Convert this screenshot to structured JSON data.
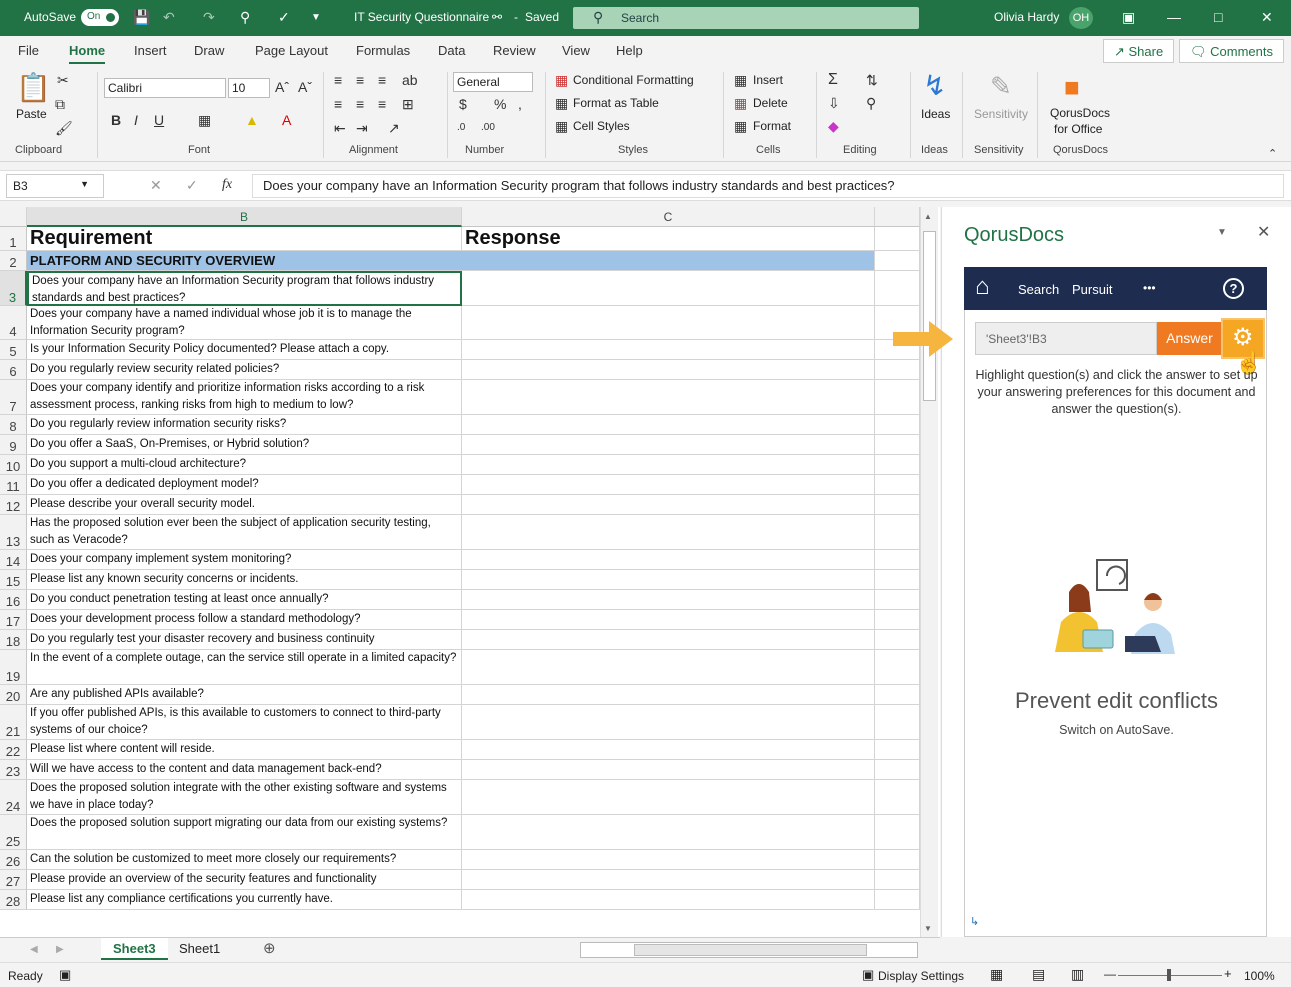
{
  "titlebar": {
    "autosave_label": "AutoSave",
    "autosave_state": "On",
    "doc_title": "IT Security Questionnaire",
    "saved": "Saved",
    "search_label": "Search",
    "user_name": "Olivia Hardy",
    "user_initials": "OH"
  },
  "tabs": [
    "File",
    "Home",
    "Insert",
    "Draw",
    "Page Layout",
    "Formulas",
    "Data",
    "Review",
    "View",
    "Help"
  ],
  "active_tab": "Home",
  "top_buttons": {
    "share": "Share",
    "comments": "Comments"
  },
  "ribbon": {
    "clipboard": {
      "paste": "Paste",
      "group": "Clipboard"
    },
    "font": {
      "name": "Calibri",
      "size": "10",
      "group": "Font"
    },
    "alignment": {
      "group": "Alignment"
    },
    "number": {
      "format": "General",
      "group": "Number"
    },
    "styles": {
      "conditional": "Conditional Formatting",
      "table": "Format as Table",
      "cell": "Cell Styles",
      "group": "Styles"
    },
    "cells": {
      "insert": "Insert",
      "delete": "Delete",
      "format": "Format",
      "group": "Cells"
    },
    "editing": {
      "group": "Editing"
    },
    "ideas": {
      "label": "Ideas",
      "group": "Ideas"
    },
    "sensitivity": {
      "label": "Sensitivity",
      "group": "Sensitivity"
    },
    "qorus": {
      "label1": "QorusDocs",
      "label2": "for Office",
      "group": "QorusDocs"
    }
  },
  "formula_bar": {
    "name_box": "B3",
    "fx": "fx",
    "content": "Does your company have an Information Security program that follows industry standards and best practices?"
  },
  "grid": {
    "columns": [
      "B",
      "C"
    ],
    "rows": [
      {
        "n": "1",
        "b": "Requirement",
        "c": "Response"
      },
      {
        "n": "2",
        "b": "PLATFORM AND SECURITY OVERVIEW",
        "c": ""
      },
      {
        "n": "3",
        "b": "Does your company have an Information Security program that follows industry standards and best practices?",
        "c": ""
      },
      {
        "n": "4",
        "b": "Does your company have a named individual whose job it is to manage the Information Security program?",
        "c": ""
      },
      {
        "n": "5",
        "b": "Is your Information Security Policy documented? Please attach a copy.",
        "c": ""
      },
      {
        "n": "6",
        "b": "Do you regularly review security related policies?",
        "c": ""
      },
      {
        "n": "7",
        "b": "Does your company identify and prioritize information risks according to a risk assessment process, ranking risks from high to medium to low?",
        "c": ""
      },
      {
        "n": "8",
        "b": "Do you regularly review information security risks?",
        "c": ""
      },
      {
        "n": "9",
        "b": "Do you offer a SaaS, On-Premises, or Hybrid solution?",
        "c": ""
      },
      {
        "n": "10",
        "b": "Do you support a multi-cloud architecture?",
        "c": ""
      },
      {
        "n": "11",
        "b": "Do you offer a dedicated deployment model?",
        "c": ""
      },
      {
        "n": "12",
        "b": "Please describe your overall security model.",
        "c": ""
      },
      {
        "n": "13",
        "b": "Has the proposed solution ever been the subject of application security testing, such as Veracode?",
        "c": ""
      },
      {
        "n": "14",
        "b": "Does your company implement system monitoring?",
        "c": ""
      },
      {
        "n": "15",
        "b": "Please list any known security concerns or incidents.",
        "c": ""
      },
      {
        "n": "16",
        "b": "Do you conduct penetration testing at least once annually?",
        "c": ""
      },
      {
        "n": "17",
        "b": "Does your development process follow a standard methodology?",
        "c": ""
      },
      {
        "n": "18",
        "b": "Do you regularly test your disaster recovery and business continuity",
        "c": ""
      },
      {
        "n": "19",
        "b": "In the event of a complete outage, can the service still operate in a limited capacity?",
        "c": ""
      },
      {
        "n": "20",
        "b": "Are any published APIs available?",
        "c": ""
      },
      {
        "n": "21",
        "b": "If you offer published APIs, is this available to customers to connect to third-party systems of our choice?",
        "c": ""
      },
      {
        "n": "22",
        "b": "Please list where content will reside.",
        "c": ""
      },
      {
        "n": "23",
        "b": "Will we have access to the content and data management back-end?",
        "c": ""
      },
      {
        "n": "24",
        "b": "Does the proposed solution integrate with the other existing software and systems we have in place today?",
        "c": ""
      },
      {
        "n": "25",
        "b": "Does the proposed solution support migrating our data from our existing systems?",
        "c": ""
      },
      {
        "n": "26",
        "b": "Can the solution be customized to meet more closely our requirements?",
        "c": ""
      },
      {
        "n": "27",
        "b": "Please provide an overview of the security features and functionality",
        "c": ""
      },
      {
        "n": "28",
        "b": "Please list any compliance certifications you currently have.",
        "c": ""
      }
    ]
  },
  "sheets": [
    "Sheet3",
    "Sheet1"
  ],
  "active_sheet": "Sheet3",
  "status": {
    "ready": "Ready",
    "display_settings": "Display Settings",
    "zoom": "100%"
  },
  "pane": {
    "title": "QorusDocs",
    "nav": {
      "search": "Search",
      "pursuit": "Pursuit",
      "more": "•••"
    },
    "ref_value": "'Sheet3'!B3",
    "answer": "Answer",
    "hint": "Highlight question(s) and click the answer to set up your answering preferences for this document and answer the question(s).",
    "heading": "Prevent edit conflicts",
    "subtext": "Switch on AutoSave."
  },
  "colors": {
    "excel_green": "#217346",
    "header_blue": "#9fc3e7",
    "qorus_navy": "#1e2c4f",
    "answer_orange": "#f07a21"
  }
}
